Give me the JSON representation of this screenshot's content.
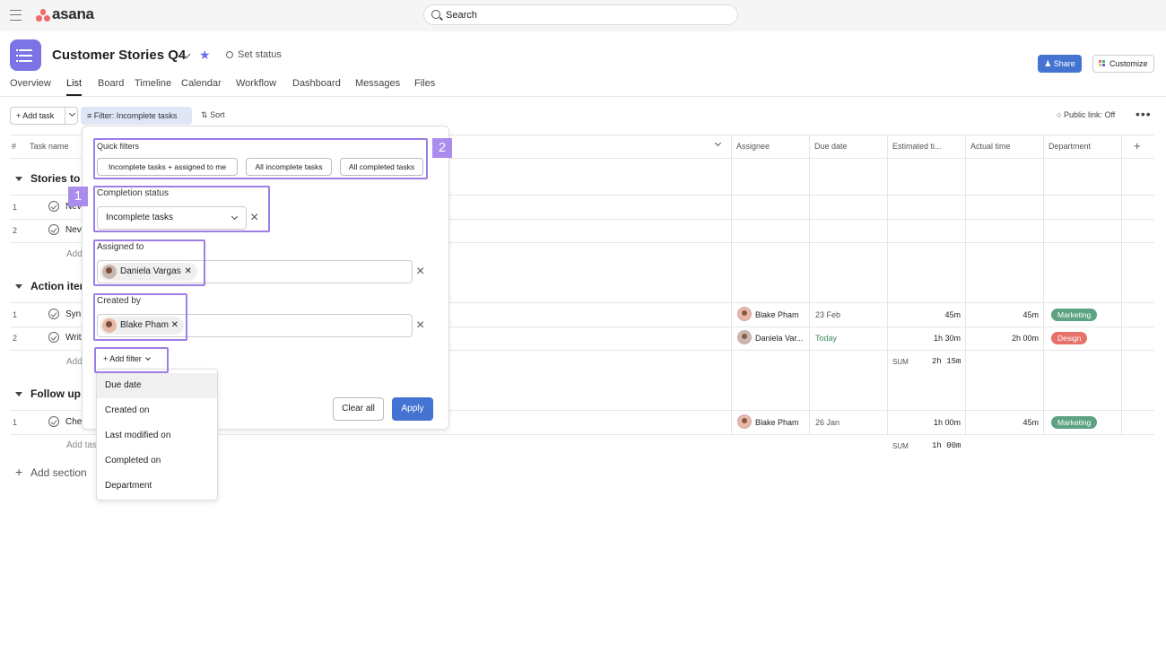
{
  "app": {
    "logo": "asana",
    "search_label": "Search",
    "menu_icon": "hamburger-icon"
  },
  "project": {
    "title": "Customer Stories Q4",
    "set_status": "Set status",
    "share": "Share",
    "customize": "Customize"
  },
  "tabs": [
    "Overview",
    "List",
    "Board",
    "Timeline",
    "Calendar",
    "Workflow",
    "Dashboard",
    "Messages",
    "Files"
  ],
  "toolbar": {
    "add_task": "Add task",
    "filter": "Filter: Incomplete tasks",
    "sort": "Sort",
    "public_link": "Public link: Off",
    "more": "•••"
  },
  "columns": {
    "num": "#",
    "task": "Task name",
    "assignee": "Assignee",
    "due": "Due date",
    "estimated": "Estimated ti...",
    "actual": "Actual time",
    "department": "Department",
    "add": "+"
  },
  "sections": [
    {
      "name": "Stories to",
      "rows": [
        {
          "num": "1",
          "name": "Nev"
        },
        {
          "num": "2",
          "name": "Nev"
        }
      ],
      "add": "Add"
    },
    {
      "name": "Action iter",
      "rows": [
        {
          "num": "1",
          "name": "Syn",
          "assignee": "Blake Pham",
          "due": "23 Feb",
          "estimated": "45m",
          "actual": "45m",
          "dept": "Marketing"
        },
        {
          "num": "2",
          "name": "Writ",
          "assignee": "Daniela Var...",
          "due": "Today",
          "estimated": "1h 30m",
          "actual": "2h 00m",
          "dept": "Design"
        }
      ],
      "add": "Add",
      "sum_label": "SUM",
      "sum": "2h 15m"
    },
    {
      "name": "Follow up",
      "rows": [
        {
          "num": "1",
          "name": "Che",
          "assignee": "Blake Pham",
          "due": "26 Jan",
          "estimated": "1h 00m",
          "actual": "45m",
          "dept": "Marketing"
        }
      ],
      "add": "Add tas",
      "sum_label": "SUM",
      "sum": "1h 00m"
    }
  ],
  "add_section": "Add section",
  "filter_panel": {
    "quick_filters_label": "Quick filters",
    "quick_filters": [
      "Incomplete tasks + assigned to me",
      "All incomplete tasks",
      "All completed tasks"
    ],
    "completion_label": "Completion status",
    "completion_value": "Incomplete tasks",
    "assigned_label": "Assigned to",
    "assigned_chip": "Daniela Vargas",
    "created_label": "Created by",
    "created_chip": "Blake Pham",
    "add_filter": "Add filter",
    "clear_all": "Clear all",
    "apply": "Apply"
  },
  "add_filter_options": [
    "Due date",
    "Created on",
    "Last modified on",
    "Completed on",
    "Department"
  ],
  "annotations": {
    "badge1": "1",
    "badge2": "2"
  },
  "colors": {
    "accent": "#4573d2",
    "highlight": "#9d7ee8",
    "marketing": "#5da283",
    "design": "#e8706a",
    "project_icon": "#7b73e6"
  }
}
